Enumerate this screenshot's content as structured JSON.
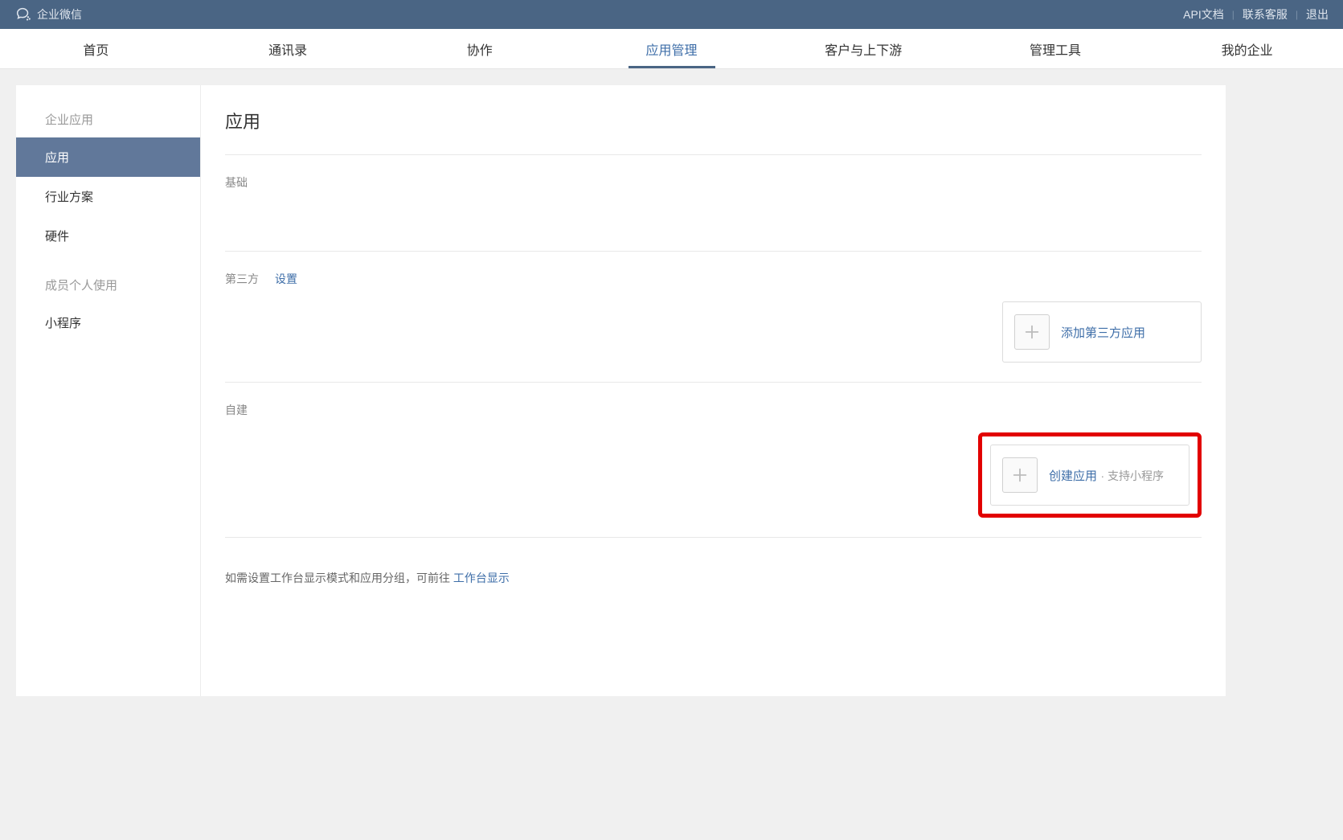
{
  "brand": "企业微信",
  "top_links": {
    "api_docs": "API文档",
    "contact": "联系客服",
    "logout": "退出"
  },
  "nav": {
    "home": "首页",
    "contacts": "通讯录",
    "collab": "协作",
    "apps": "应用管理",
    "customers": "客户与上下游",
    "tools": "管理工具",
    "my_enterprise": "我的企业"
  },
  "sidebar": {
    "group1_title": "企业应用",
    "item_apps": "应用",
    "item_industry": "行业方案",
    "item_hardware": "硬件",
    "group2_title": "成员个人使用",
    "item_miniprog": "小程序"
  },
  "main": {
    "title": "应用",
    "section_basic": "基础",
    "section_thirdparty": "第三方",
    "thirdparty_settings": "设置",
    "add_thirdparty": "添加第三方应用",
    "section_selfbuild": "自建",
    "create_app": "创建应用",
    "create_app_sub": "· 支持小程序",
    "footer_pre": "如需设置工作台显示模式和应用分组，可前往 ",
    "footer_link": "工作台显示"
  }
}
